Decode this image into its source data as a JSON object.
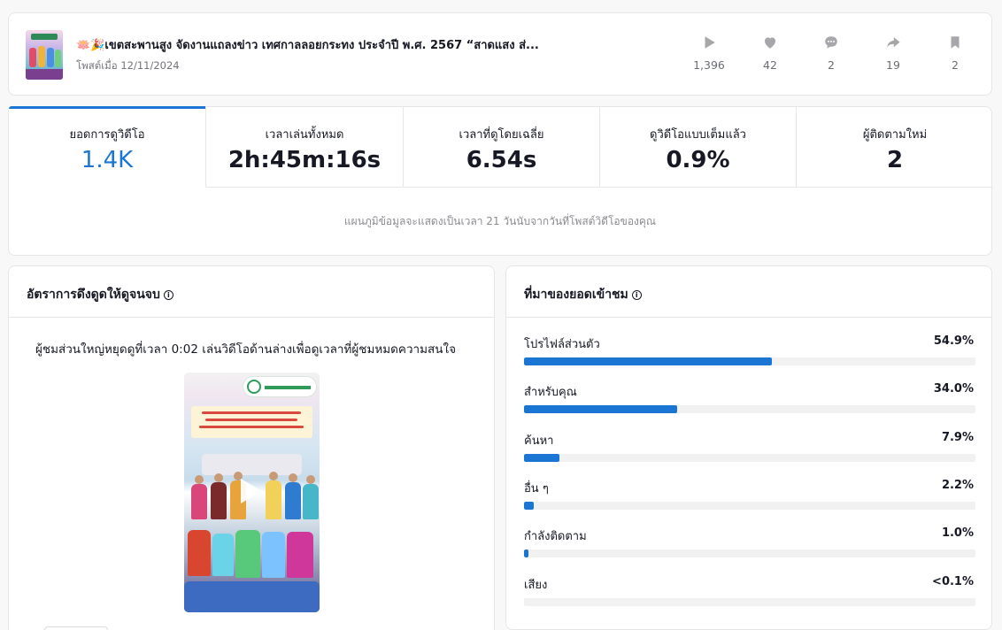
{
  "post": {
    "title": "🪷🎉เขตสะพานสูง จัดงานแถลงข่าว เทศกาลลอยกระทง ประจำปี พ.ศ. 2567 “สาดแสง ส่...",
    "posted_on": "โพสต์เมื่อ 12/11/2024",
    "stats": {
      "plays": "1,396",
      "likes": "42",
      "comments": "2",
      "shares": "19",
      "saves": "2"
    }
  },
  "metrics": {
    "tabs": [
      {
        "label": "ยอดการดูวิดีโอ",
        "value": "1.4K"
      },
      {
        "label": "เวลาเล่นทั้งหมด",
        "value": "2h:45m:16s"
      },
      {
        "label": "เวลาที่ดูโดยเฉลี่ย",
        "value": "6.54s"
      },
      {
        "label": "ดูวิดีโอแบบเต็มแล้ว",
        "value": "0.9%"
      },
      {
        "label": "ผู้ติดตามใหม่",
        "value": "2"
      }
    ],
    "note": "แผนภูมิข้อมูลจะแสดงเป็นเวลา 21 วันนับจากวันที่โพสต์วิดีโอของคุณ"
  },
  "retention": {
    "title": "อัตราการดึงดูดให้ดูจนจบ",
    "description": "ผู้ชมส่วนใหญ่หยุดดูที่เวลา 0:02 เล่นวิดีโอด้านล่างเพื่อดูเวลาที่ผู้ชมหมดความสนใจ"
  },
  "traffic": {
    "title": "ที่มาของยอดเข้าชม",
    "sources": [
      {
        "label": "โปรไฟล์ส่วนตัว",
        "percent_text": "54.9%",
        "fraction": 0.549
      },
      {
        "label": "สำหรับคุณ",
        "percent_text": "34.0%",
        "fraction": 0.34
      },
      {
        "label": "ค้นหา",
        "percent_text": "7.9%",
        "fraction": 0.079
      },
      {
        "label": "อื่น ๆ",
        "percent_text": "2.2%",
        "fraction": 0.022
      },
      {
        "label": "กำลังติดตาม",
        "percent_text": "1.0%",
        "fraction": 0.01
      },
      {
        "label": "เสียง",
        "percent_text": "<0.1%",
        "fraction": 0.0
      }
    ]
  },
  "colors": {
    "accent": "#1a76d2",
    "icon_gray": "#a7a7ab"
  },
  "icons": [
    "play-icon",
    "heart-icon",
    "comment-icon",
    "share-icon",
    "bookmark-icon",
    "info-icon"
  ]
}
